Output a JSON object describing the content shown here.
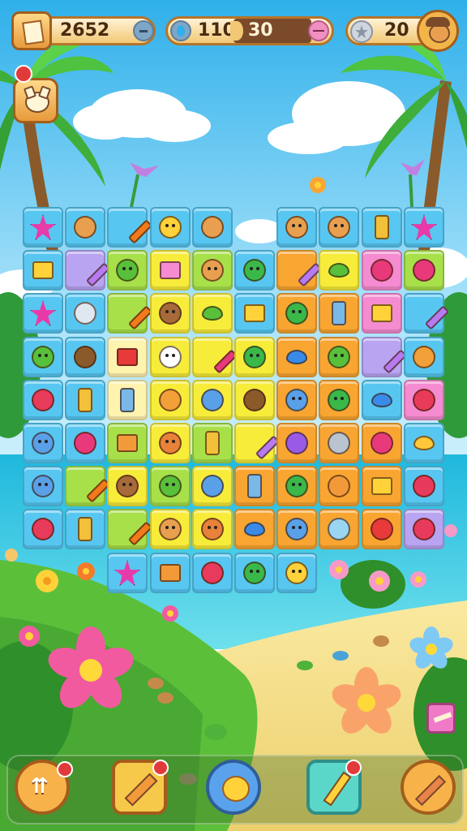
{
  "hud": {
    "coins": "2652",
    "gems": "110",
    "moves": "30",
    "score": "20"
  },
  "colors": {
    "sky_top": "#3fb6ec",
    "sky_bottom": "#bfe9fb",
    "sea": "#34c3e3",
    "sand": "#f4de8a",
    "grass": "#4fb23a",
    "tile_colors": {
      "blue": "#57c7f2",
      "yellow": "#f7ec3a",
      "green": "#a8e04a",
      "orange": "#f9a531",
      "purple": "#b9a4f2",
      "pink": "#f58bd0",
      "cream": "#fff3b0"
    }
  },
  "board": {
    "rows": [
      [
        "blue-star",
        "blue-bread",
        "blue-carrot",
        "blue-chick",
        "blue-bread",
        null,
        "blue-face",
        "blue-face",
        "blue-jar",
        "blue-star"
      ],
      [
        "blue-cheese",
        "purple-pencil",
        "green-smile",
        "yellow-eraser",
        "green-face",
        "blue-blob",
        "orange-pencil",
        "yellow-leaf",
        "pink-apple",
        "green-apple"
      ],
      [
        "blue-star",
        "blue-boot",
        "green-carrot",
        "yellow-bear",
        "yellow-leaf",
        "blue-cheese",
        "orange-blob",
        "orange-bottle",
        "pink-cheese",
        "blue-pencil"
      ],
      [
        "blue-bird",
        "blue-coco",
        "cream-gift",
        "yellow-ghost",
        "yellow-candy",
        "yellow-blob",
        "orange-drop",
        "orange-bird",
        "purple-pencil",
        "blue-flower"
      ],
      [
        "blue-berry",
        "blue-jar",
        "cream-bottle",
        "yellow-flower",
        "yellow-rocket",
        "yellow-coco",
        "orange-cat",
        "orange-blob",
        "blue-drop",
        "pink-berry"
      ],
      [
        "blue-cat",
        "blue-apple",
        "green-box",
        "yellow-ant",
        "green-jar",
        "yellow-pencil",
        "orange-ball",
        "orange-fish",
        "orange-apple",
        "blue-lemon"
      ],
      [
        "blue-cat",
        "green-carrot",
        "yellow-bear",
        "green-smile",
        "yellow-rocket",
        "orange-bottle",
        "orange-blob",
        "orange-sun",
        "orange-cheese",
        "blue-berry"
      ],
      [
        "blue-berry",
        "blue-jar",
        "green-carrot",
        "yellow-face",
        "yellow-ant",
        "orange-drop",
        "orange-cat",
        "orange-cup",
        "orange-robot",
        "purple-berry"
      ]
    ],
    "extra_row": [
      "blue-star",
      "blue-box",
      "blue-berry",
      "blue-blob",
      "blue-chick"
    ]
  },
  "bottom_bar": {
    "buttons": [
      "shuffle-button",
      "hammer-button",
      "hint-button",
      "wand-button",
      "pick-button"
    ]
  }
}
